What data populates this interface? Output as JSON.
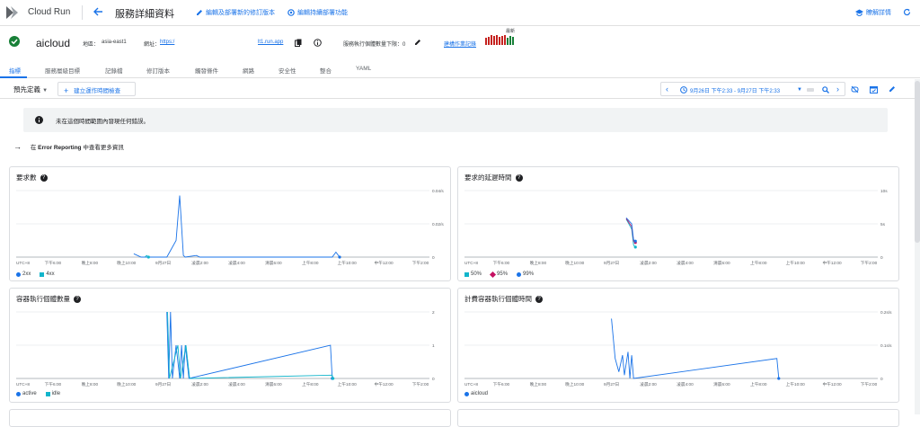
{
  "topbar": {
    "brand": "Cloud Run",
    "page_title": "服務詳細資料",
    "actions": [
      "編輯及部署新的修訂版本",
      "編輯持續部署功能"
    ],
    "learn_label": "瞭解詳情"
  },
  "service": {
    "name": "aicloud",
    "region_label": "地區：",
    "region": "asia-east1",
    "url_label": "網址：",
    "url": "https:/",
    "domain": "lt1.run.app",
    "min_instances_label": "服務執行個體數量下限：0",
    "builds_link": "建構作業記錄",
    "sparkline_label": "最新"
  },
  "tabs": [
    "指標",
    "服務層級目標",
    "記錄檔",
    "修訂版本",
    "觸發條件",
    "網路",
    "安全性",
    "整合",
    "YAML"
  ],
  "toolbar": {
    "preset": "預先定義",
    "add_button": "建立運作時間檢查",
    "time_range": "9月26日 下午2:33 - 9月27日 下午2:33"
  },
  "alert": {
    "text": "未在這個時間範圍內發現任何錯誤。"
  },
  "error_link": {
    "prefix": "在 ",
    "strong": "Error Reporting",
    "suffix": " 中查看更多資訊"
  },
  "x_ticks": [
    "UTC+8",
    "下午6:00",
    "晚上8:00",
    "晚上10:00",
    "9月27日",
    "凌晨2:00",
    "凌晨4:00",
    "清晨6:00",
    "上午8:00",
    "上午10:00",
    "中午12:00",
    "下午2:00"
  ],
  "colors": {
    "blue": "#1a73e8",
    "teal": "#12b5cb",
    "magenta": "#c51162",
    "accent": "#1a73e8"
  },
  "chart_data": [
    {
      "type": "line",
      "title": "要求數",
      "y_ticks": [
        "0.04/s",
        "0.02/s",
        "0"
      ],
      "ylim": [
        0,
        0.04
      ],
      "series": [
        {
          "name": "2xx",
          "color": "#1a73e8",
          "points": [
            [
              3.2,
              0.002
            ],
            [
              3.4,
              0
            ],
            [
              4.1,
              0
            ],
            [
              4.25,
              0.006
            ],
            [
              4.35,
              0.01
            ],
            [
              4.45,
              0.037
            ],
            [
              4.55,
              0.001
            ],
            [
              4.6,
              0
            ],
            [
              4.9,
              0.001
            ],
            [
              5.0,
              0
            ],
            [
              8.6,
              0
            ],
            [
              8.7,
              0.003
            ],
            [
              8.8,
              0
            ]
          ]
        },
        {
          "name": "4xx",
          "color": "#12b5cb",
          "points": [
            [
              3.5,
              0
            ],
            [
              3.55,
              0.001
            ],
            [
              3.6,
              0
            ]
          ]
        }
      ]
    },
    {
      "type": "line",
      "title": "要求的延遲時間",
      "y_ticks": [
        "10s",
        "5s",
        "0"
      ],
      "ylim": [
        0,
        10
      ],
      "series": [
        {
          "name": "50%",
          "color": "#12b5cb",
          "points": [
            [
              4.4,
              5.7
            ],
            [
              4.55,
              4.2
            ],
            [
              4.6,
              1.8
            ],
            [
              4.65,
              1.5
            ]
          ]
        },
        {
          "name": "95%",
          "color": "#c51162",
          "points": [
            [
              4.4,
              5.8
            ],
            [
              4.55,
              4.6
            ],
            [
              4.6,
              2.4
            ],
            [
              4.65,
              2.2
            ]
          ]
        },
        {
          "name": "99%",
          "color": "#1a73e8",
          "points": [
            [
              4.4,
              5.9
            ],
            [
              4.55,
              5.0
            ],
            [
              4.6,
              2.6
            ],
            [
              4.65,
              2.4
            ]
          ]
        }
      ]
    },
    {
      "type": "line",
      "title": "容器執行個體數量",
      "y_ticks": [
        "2",
        "1",
        "0"
      ],
      "ylim": [
        0,
        2
      ],
      "series": [
        {
          "name": "active",
          "color": "#1a73e8",
          "points": [
            [
              4.1,
              2
            ],
            [
              4.15,
              0
            ],
            [
              4.2,
              2
            ],
            [
              4.25,
              0
            ],
            [
              4.35,
              1
            ],
            [
              4.45,
              0
            ],
            [
              4.5,
              1
            ],
            [
              4.55,
              0
            ],
            [
              4.6,
              1
            ],
            [
              4.7,
              0
            ],
            [
              8.55,
              1
            ],
            [
              8.6,
              0
            ]
          ]
        },
        {
          "name": "idle",
          "color": "#12b5cb",
          "points": [
            [
              4.12,
              2
            ],
            [
              4.17,
              0
            ],
            [
              4.4,
              1
            ],
            [
              4.47,
              0
            ],
            [
              4.62,
              1
            ],
            [
              4.72,
              0
            ],
            [
              8.6,
              0.1
            ],
            [
              8.62,
              0
            ]
          ]
        }
      ]
    },
    {
      "type": "line",
      "title": "計費容器執行個體時間",
      "y_ticks": [
        "0.2s/s",
        "0.1s/s",
        "0"
      ],
      "ylim": [
        0,
        0.2
      ],
      "series": [
        {
          "name": "aicloud",
          "color": "#1a73e8",
          "points": [
            [
              4.0,
              0.18
            ],
            [
              4.1,
              0.06
            ],
            [
              4.2,
              0.02
            ],
            [
              4.3,
              0.07
            ],
            [
              4.35,
              0.01
            ],
            [
              4.45,
              0.08
            ],
            [
              4.5,
              0
            ],
            [
              4.55,
              0.07
            ],
            [
              4.6,
              0
            ],
            [
              8.5,
              0.06
            ],
            [
              8.55,
              0
            ]
          ]
        }
      ]
    }
  ]
}
